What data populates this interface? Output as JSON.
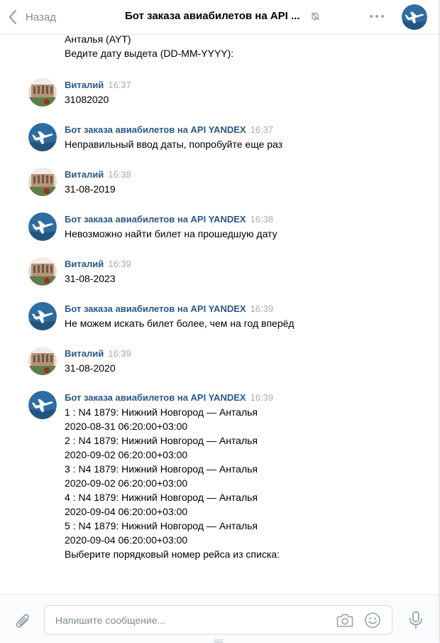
{
  "header": {
    "back_label": "Назад",
    "title": "Бот заказа авиабилетов на API ..."
  },
  "previous": {
    "lines": [
      "Анталья (AYT)",
      "Ведите дату выдета (DD-MM-YYYY):"
    ]
  },
  "messages": [
    {
      "author": "Виталий",
      "time": "16:37",
      "avatar": "user",
      "lines": [
        "31082020"
      ]
    },
    {
      "author": "Бот заказа авиабилетов на API YANDEX",
      "time": "16:37",
      "avatar": "bot",
      "lines": [
        "Неправильный ввод даты, попробуйте еще раз"
      ]
    },
    {
      "author": "Виталий",
      "time": "16:38",
      "avatar": "user",
      "lines": [
        "31-08-2019"
      ]
    },
    {
      "author": "Бот заказа авиабилетов на API YANDEX",
      "time": "16:38",
      "avatar": "bot",
      "lines": [
        "Невозможно найти билет на прошедшую дату"
      ]
    },
    {
      "author": "Виталий",
      "time": "16:39",
      "avatar": "user",
      "lines": [
        "31-08-2023"
      ]
    },
    {
      "author": "Бот заказа авиабилетов на API YANDEX",
      "time": "16:39",
      "avatar": "bot",
      "lines": [
        "Не можем искать билет более, чем на год вперёд"
      ]
    },
    {
      "author": "Виталий",
      "time": "16:39",
      "avatar": "user",
      "lines": [
        "31-08-2020"
      ]
    },
    {
      "author": "Бот заказа авиабилетов на API YANDEX",
      "time": "16:39",
      "avatar": "bot",
      "lines": [
        "1 : N4 1879: Нижний Новгород — Анталья",
        "2020-08-31 06:20:00+03:00",
        "2 : N4 1879: Нижний Новгород — Анталья",
        "2020-09-02 06:20:00+03:00",
        "3 : N4 1879: Нижний Новгород — Анталья",
        "2020-09-02 06:20:00+03:00",
        "4 : N4 1879: Нижний Новгород — Анталья",
        "2020-09-04 06:20:00+03:00",
        "5 : N4 1879: Нижний Новгород — Анталья",
        "2020-09-04 06:20:00+03:00",
        "Выберите порядковый номер рейса из списка:"
      ]
    }
  ],
  "composer": {
    "placeholder": "Напишите сообщение..."
  },
  "icons": {
    "back": "chevron-left-icon",
    "mute": "muted-bell-icon",
    "more": "more-dots-icon",
    "attach": "paperclip-icon",
    "camera": "camera-icon",
    "smile": "smile-icon",
    "mic": "microphone-icon"
  },
  "colors": {
    "author": "#2a5885",
    "time": "#a8adb3",
    "back_label": "#818c99",
    "bot_avatar": "#2e6da1"
  }
}
